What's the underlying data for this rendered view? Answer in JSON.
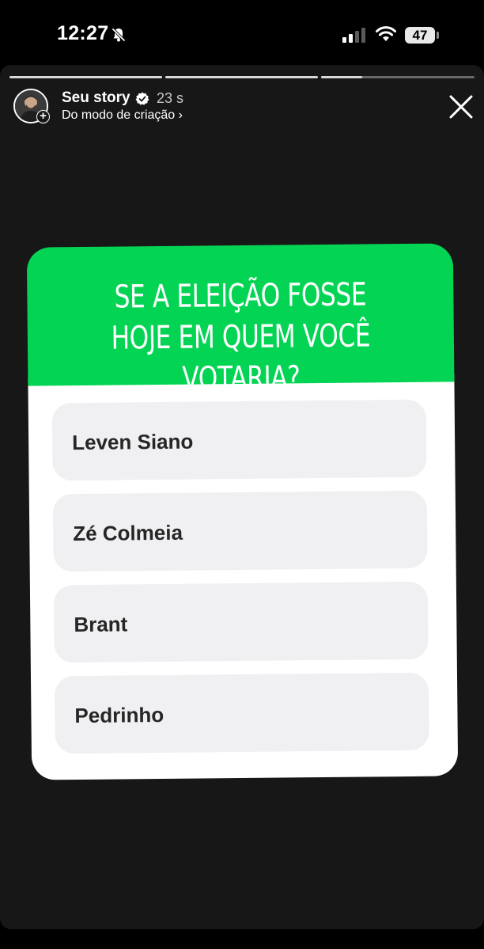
{
  "status_bar": {
    "time": "12:27",
    "battery": "47"
  },
  "story": {
    "title": "Seu story",
    "time_ago": "23 s",
    "subtitle": "Do modo de criação ›"
  },
  "poll": {
    "question": "SE A ELEIÇÃO FOSSE HOJE EM QUEM VOCÊ VOTARIA?",
    "options": [
      {
        "label": "Leven Siano"
      },
      {
        "label": "Zé Colmeia"
      },
      {
        "label": "Brant"
      },
      {
        "label": "Pedrinho"
      }
    ]
  },
  "colors": {
    "poll_header": "#04d453",
    "background": "#171717",
    "option_bg": "#f0f0f2"
  }
}
